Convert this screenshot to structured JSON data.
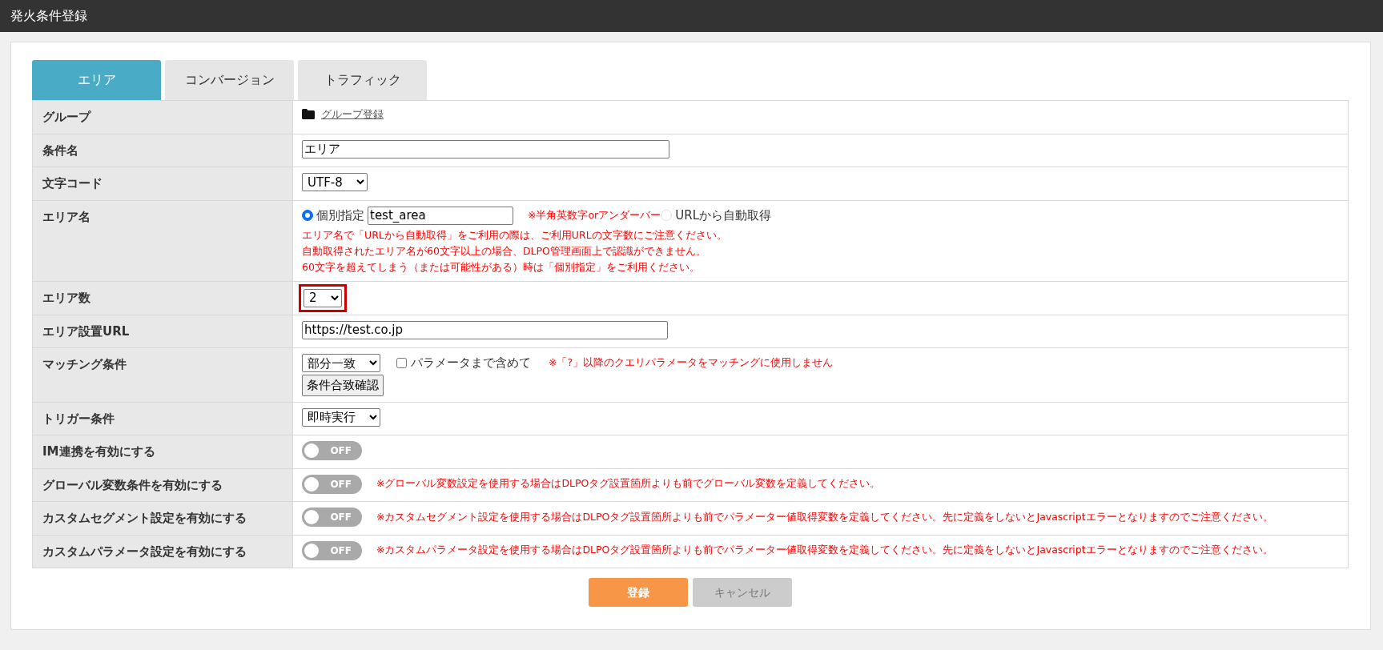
{
  "window": {
    "title": "発火条件登録"
  },
  "tabs": [
    {
      "label": "エリア",
      "selected": true
    },
    {
      "label": "コンバージョン",
      "selected": false
    },
    {
      "label": "トラフィック",
      "selected": false
    }
  ],
  "rows": [
    {
      "label": "グループ",
      "kind": "link",
      "link": "グループ登録"
    },
    {
      "label": "条件名",
      "kind": "text",
      "value": "エリア"
    },
    {
      "label": "文字コード",
      "kind": "select",
      "value": "UTF-8"
    },
    {
      "label": "エリア名",
      "kind": "area_name",
      "options": [
        {
          "label": "個別指定",
          "selected": true,
          "value": "test_area",
          "note": "※半角英数字orアンダーバー"
        },
        {
          "label": "URLから自動取得",
          "selected": false
        }
      ],
      "notes": [
        "エリア名で「URLから自動取得」をご利用の際は、ご利用URLの文字数にご注意ください。",
        "自動取得されたエリア名が60文字以上の場合、DLPO管理画面上で認識ができません。",
        "60文字を超えてしまう（または可能性がある）時は「個別指定」をご利用ください。"
      ]
    },
    {
      "label": "エリア数",
      "kind": "select",
      "value": "2",
      "highlighted": true
    },
    {
      "label": "エリア設置URL",
      "kind": "text",
      "value": "https://test.co.jp"
    },
    {
      "label": "マッチング条件",
      "kind": "matching",
      "value": "部分一致",
      "checkbox": {
        "label": "パラメータまで含めて",
        "checked": false
      },
      "note": "※「?」以降のクエリパラメータをマッチングに使用しません",
      "button": "条件合致確認"
    },
    {
      "label": "トリガー条件",
      "kind": "select",
      "value": "即時実行"
    },
    {
      "label": "IM連携を有効にする",
      "kind": "toggle",
      "on": false,
      "state_text": "OFF"
    },
    {
      "label": "グローバル変数条件を有効にする",
      "kind": "toggle",
      "on": false,
      "state_text": "OFF",
      "note": "※グローバル変数設定を使用する場合はDLPOタグ設置箇所よりも前でグローバル変数を定義してください。"
    },
    {
      "label": "カスタムセグメント設定を有効にする",
      "kind": "toggle",
      "on": false,
      "state_text": "OFF",
      "note": "※カスタムセグメント設定を使用する場合はDLPOタグ設置箇所よりも前でパラメーター値取得変数を定義してください。先に定義をしないとJavascriptエラーとなりますのでご注意ください。"
    },
    {
      "label": "カスタムパラメータ設定を有効にする",
      "kind": "toggle",
      "on": false,
      "state_text": "OFF",
      "note": "※カスタムパラメータ設定を使用する場合はDLPOタグ設置箇所よりも前でパラメーター値取得変数を定義してください。先に定義をしないとJavascriptエラーとなりますのでご注意ください。"
    }
  ],
  "buttons": [
    {
      "label": "登録",
      "kind": "primary"
    },
    {
      "label": "キャンセル",
      "kind": "secondary"
    }
  ]
}
